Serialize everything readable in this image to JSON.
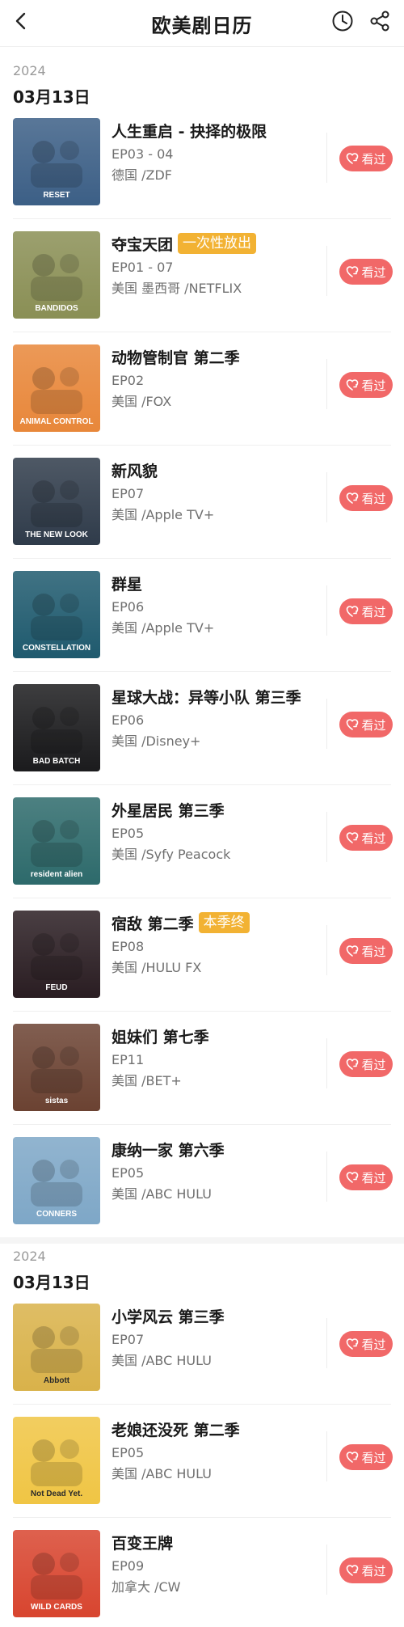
{
  "header": {
    "title": "欧美剧日历",
    "back_icon": "chevron-left-icon",
    "history_icon": "clock-icon",
    "share_icon": "share-icon"
  },
  "sections": [
    {
      "year": "2024",
      "date": "03月13日",
      "items": [
        {
          "title": "人生重启 - 抉择的极限",
          "tag": "",
          "episode": "EP03 - 04",
          "region": "德国 /ZDF",
          "button": "看过",
          "poster_text": "RESET",
          "poster_color": "#3c5f86"
        },
        {
          "title": "夺宝天团",
          "tag": "一次性放出",
          "episode": "EP01 - 07",
          "region": "美国 墨西哥 /NETFLIX",
          "button": "看过",
          "poster_text": "BANDIDOS",
          "poster_color": "#8a8f55"
        },
        {
          "title": "动物管制官 第二季",
          "tag": "",
          "episode": "EP02",
          "region": "美国 /FOX",
          "button": "看过",
          "poster_text": "ANIMAL CONTROL",
          "poster_color": "#e8873a"
        },
        {
          "title": "新风貌",
          "tag": "",
          "episode": "EP07",
          "region": "美国 /Apple TV+",
          "button": "看过",
          "poster_text": "THE NEW LOOK",
          "poster_color": "#2f3b4a"
        },
        {
          "title": "群星",
          "tag": "",
          "episode": "EP06",
          "region": "美国 /Apple TV+",
          "button": "看过",
          "poster_text": "CONSTELLATION",
          "poster_color": "#1f5a6e"
        },
        {
          "title": "星球大战：异等小队 第三季",
          "tag": "",
          "episode": "EP06",
          "region": "美国 /Disney+",
          "button": "看过",
          "poster_text": "BAD BATCH",
          "poster_color": "#1b1b1d"
        },
        {
          "title": "外星居民 第三季",
          "tag": "",
          "episode": "EP05",
          "region": "美国 /Syfy Peacock",
          "button": "看过",
          "poster_text": "resident alien",
          "poster_color": "#2d6a6b"
        },
        {
          "title": "宿敌 第二季",
          "tag": "本季终",
          "episode": "EP08",
          "region": "美国 /HULU FX",
          "button": "看过",
          "poster_text": "FEUD",
          "poster_color": "#2a1d22"
        },
        {
          "title": "姐妹们 第七季",
          "tag": "",
          "episode": "EP11",
          "region": "美国 /BET+",
          "button": "看过",
          "poster_text": "sistas",
          "poster_color": "#6b4232"
        },
        {
          "title": "康纳一家 第六季",
          "tag": "",
          "episode": "EP05",
          "region": "美国 /ABC HULU",
          "button": "看过",
          "poster_text": "CONNERS",
          "poster_color": "#7ea7c7"
        }
      ]
    },
    {
      "year": "2024",
      "date": "03月13日",
      "items": [
        {
          "title": "小学风云 第三季",
          "tag": "",
          "episode": "EP07",
          "region": "美国 /ABC HULU",
          "button": "看过",
          "poster_text": "Abbott",
          "poster_color": "#d9b24a"
        },
        {
          "title": "老娘还没死 第二季",
          "tag": "",
          "episode": "EP05",
          "region": "美国 /ABC HULU",
          "button": "看过",
          "poster_text": "Not Dead Yet.",
          "poster_color": "#f0c544"
        },
        {
          "title": "百变王牌",
          "tag": "",
          "episode": "EP09",
          "region": "加拿大 /CW",
          "button": "看过",
          "poster_text": "WILD CARDS",
          "poster_color": "#d8452f"
        }
      ]
    }
  ],
  "colors": {
    "accent_button": "#f16868",
    "tag_bg": "#f2b233",
    "secondary_text": "#707070",
    "year_text": "#9a9a9a"
  }
}
